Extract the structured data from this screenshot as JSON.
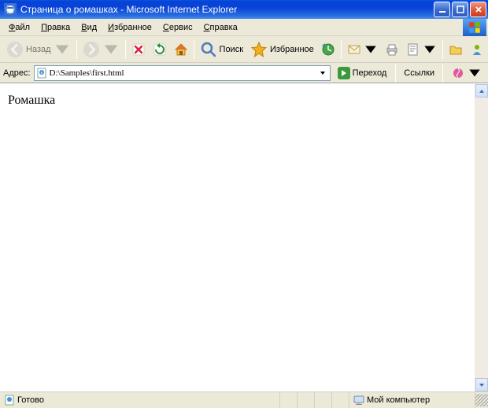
{
  "window": {
    "title": "Страница о ромашках - Microsoft Internet Explorer"
  },
  "menu": {
    "file": "Файл",
    "edit": "Правка",
    "view": "Вид",
    "favorites": "Избранное",
    "tools": "Сервис",
    "help": "Справка"
  },
  "toolbar": {
    "back": "Назад",
    "search": "Поиск",
    "favorites": "Избранное"
  },
  "address": {
    "label": "Адрес:",
    "value": "D:\\Samples\\first.html",
    "go": "Переход",
    "links": "Ссылки"
  },
  "page": {
    "body_text": "Ромашка"
  },
  "status": {
    "ready": "Готово",
    "zone": "Мой компьютер"
  }
}
